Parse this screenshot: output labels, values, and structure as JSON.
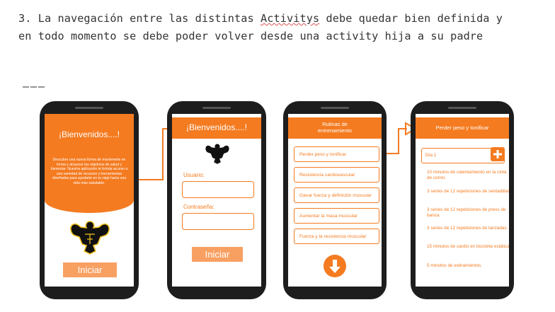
{
  "heading": {
    "line1_before": "3. La navegación entre las distintas ",
    "line1_squiggle": "Activitys",
    "line1_after": " debe quedar bien definida y",
    "line2": "en todo momento se debe poder volver desde una activity hija a su padre"
  },
  "separator": "———",
  "colors": {
    "accent": "#f47b20",
    "button": "#f8a062",
    "phone": "#1d1d1d"
  },
  "screen1": {
    "title": "¡Bienvenidos....!",
    "body": "Descubre una nueva forma de mantenerte en forma y alcanzar tus objetivos de salud y bienestar. Nuestra aplicación te brinda acceso a una variedad de recursos y herramientas diseñadas para ayudarte en tu viaje hacia una vida más saludable.",
    "button": "Iniciar",
    "logo_icon": "bodybuilder-logo-icon"
  },
  "screen2": {
    "title": "¡Bienvenidos....!",
    "user_label": "Usuario:",
    "password_label": "Contraseña:",
    "button": "Iniciar"
  },
  "screen3": {
    "title": "Rutinas de entrenamiento",
    "items": [
      "Perder peso y tonificar",
      "Resistencia cardiovascular",
      "Ganar fuerza y definición muscular",
      "Aumentar la masa muscular",
      "Fuerza y la resistencia muscular"
    ],
    "fab_icon": "arrow-down-icon"
  },
  "screen4": {
    "title": "Perder peso y tonificar",
    "day": "Día 1",
    "add_icon": "plus-icon",
    "tasks": [
      "10 minutos de calentamiento en la cinta de correr.",
      "3 series de 12 repeticiones de sentadillas.",
      "3 series de 12 repeticiones de press de banca.",
      "3 series de 12 repeticiones de lanzadas.",
      "15 minutos de cardio en bicicleta estática.",
      "5 minutos de estiramientos."
    ]
  }
}
